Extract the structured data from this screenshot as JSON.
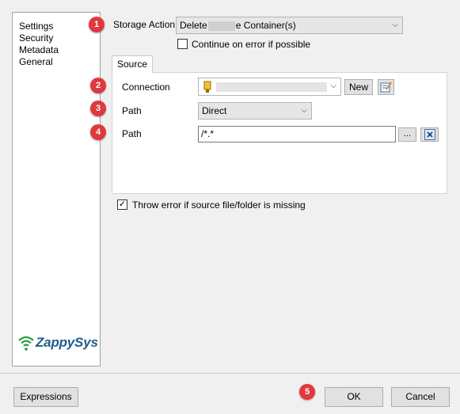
{
  "sidebar": {
    "items": [
      {
        "label": "Settings"
      },
      {
        "label": "Security"
      },
      {
        "label": "Metadata"
      },
      {
        "label": "General"
      }
    ],
    "logo_text": "ZappySys"
  },
  "markers": [
    "1",
    "2",
    "3",
    "4",
    "5"
  ],
  "storage_action": {
    "label": "Storage Action",
    "value_prefix": "Delete",
    "value_suffix": "e Container(s)"
  },
  "continue_on_error": {
    "label": "Continue on error if possible",
    "checked": false
  },
  "source_tab": {
    "label": "Source"
  },
  "connection": {
    "label": "Connection",
    "new_label": "New"
  },
  "path_type": {
    "label": "Path",
    "value": "Direct"
  },
  "path_value": {
    "label": "Path",
    "value": "/*.*",
    "browse_label": "..."
  },
  "throw_error": {
    "label": "Throw error if source file/folder is missing",
    "checked": true,
    "check_mark": "✓"
  },
  "footer": {
    "expressions_label": "Expressions",
    "ok_label": "OK",
    "cancel_label": "Cancel"
  },
  "colors": {
    "badge": "#e0383e",
    "logo_green": "#2c9a3c",
    "logo_blue": "#1f5d8f"
  }
}
